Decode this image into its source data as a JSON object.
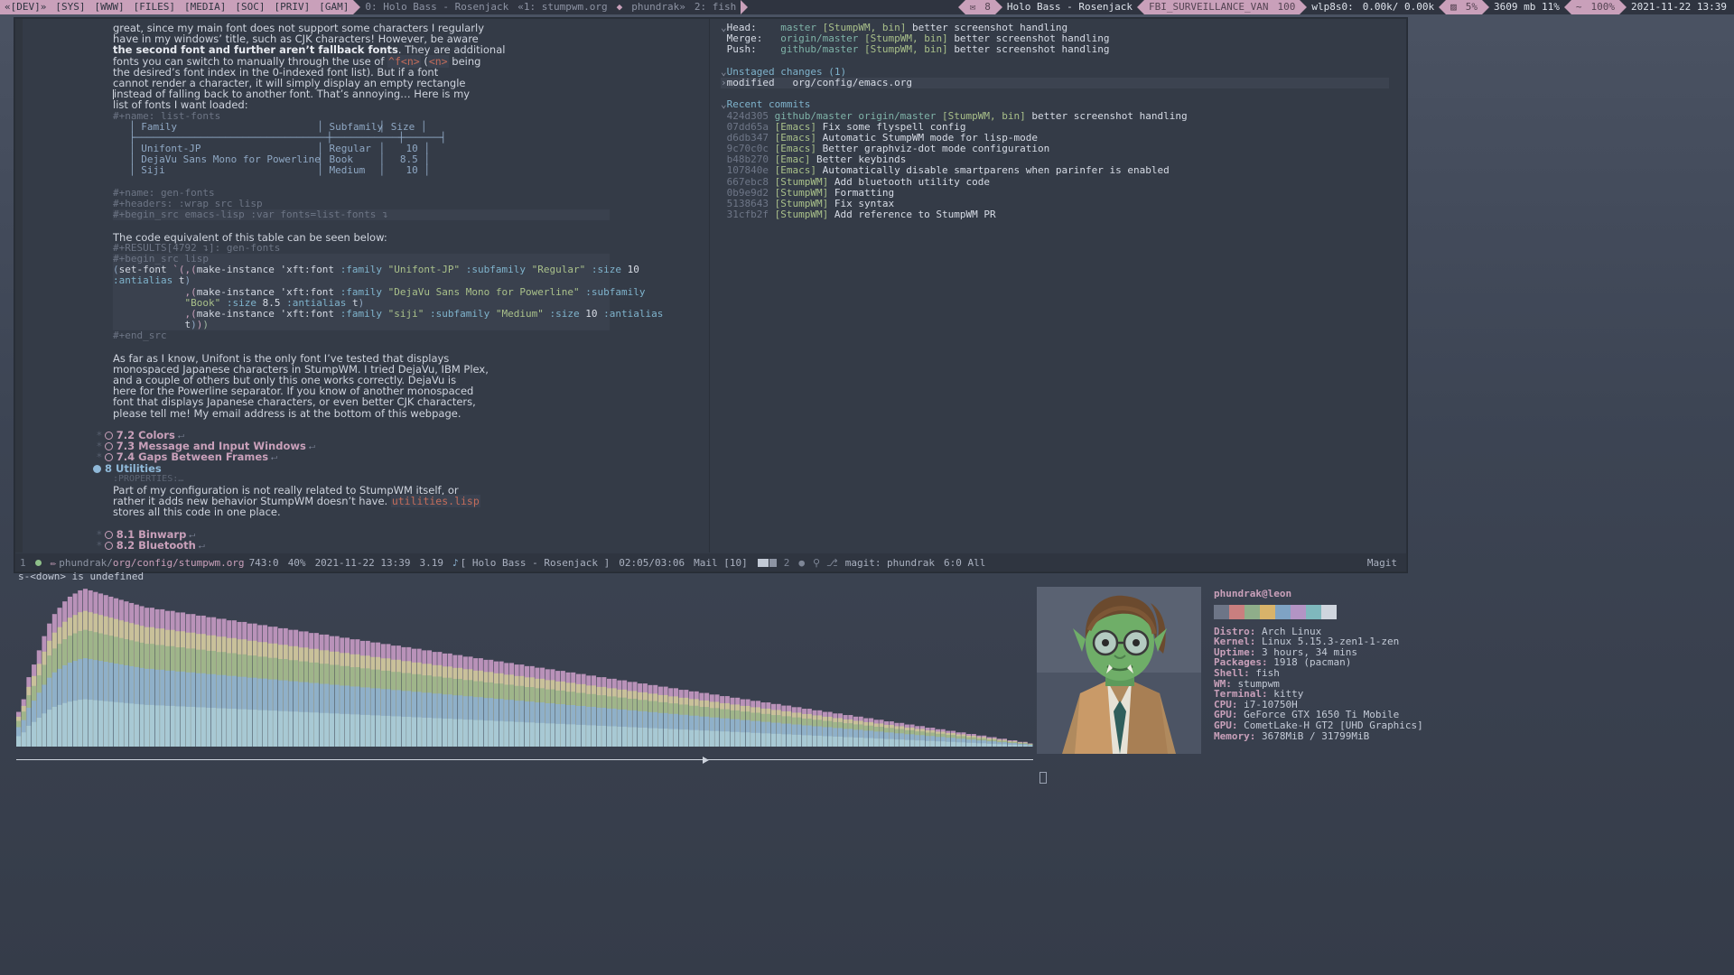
{
  "topbar": {
    "groups": [
      "«[DEV]»",
      "[SYS]",
      "[WWW]",
      "[FILES]",
      "[MEDIA]",
      "[SOC]",
      "[PRIV]",
      "[GAM]"
    ],
    "windows": [
      {
        "label": "0: Holo Bass - Rosenjack",
        "active": false
      },
      {
        "label": "«1: stumpwm.org",
        "active": true
      },
      {
        "label": "phundrak»",
        "active": false
      },
      {
        "label": "2: fish",
        "active": false
      }
    ],
    "mail_icon": "mail-icon",
    "mail_count": "8",
    "now_playing": "Holo Bass - Rosenjack",
    "wifi_ssid": "FBI_SURVEILLANCE_VAN",
    "wifi_strength": "100",
    "net_iface": "wlp8s0:",
    "net_rate": "0.00k/ 0.00k",
    "cpu_icon": "cpu-icon",
    "cpu_pct": "5%",
    "mem": "3609 mb 11%",
    "battery_icon": "~",
    "battery_pct": "100%",
    "datetime": "2021-11-22 13:39"
  },
  "emacs": {
    "left_window": {
      "paragraph_top": [
        "great, since my main font does not support some characters I regularly",
        "have in my windows’ title, such as CJK characters! However, be aware"
      ],
      "bold_sentence": "the second font and further aren’t fallback fonts",
      "paragraph_top_cont": [
        ". They are additional",
        "fonts you can switch to manually through the use of ^f<n> (<n> being",
        "the desired’s font index in the 0-indexed font list). But if a font",
        "cannot render a character, it will simply display an empty rectangle",
        "instead of falling back to another font. That’s annoying… Here is my",
        "list of fonts I want loaded:"
      ],
      "verbatim_1": "^f<n>",
      "verbatim_2": "<n>",
      "table_name": "#+name: list-fonts",
      "table": {
        "headers": [
          "Family",
          "Subfamily",
          "Size"
        ],
        "rows": [
          [
            "Unifont-JP",
            "Regular",
            "10"
          ],
          [
            "DejaVu Sans Mono for Powerline",
            "Book",
            "8.5"
          ],
          [
            "Siji",
            "Medium",
            "10"
          ]
        ]
      },
      "src_name": "#+name: gen-fonts",
      "src_headers": "#+headers: :wrap src lisp",
      "src_begin": "#+begin_src emacs-lisp :var fonts=list-fonts ↴",
      "results_intro": "The code equivalent of this table can be seen below:",
      "results_line": "#+RESULTS[4792 ↴]: gen-fonts",
      "lisp_begin": "#+begin_src lisp",
      "lisp_code": [
        "(set-font `(,(make-instance 'xft:font :family \"Unifont-JP\" :subfamily \"Regular\" :size 10",
        ":antialias t)",
        "            ,(make-instance 'xft:font :family \"DejaVu Sans Mono for Powerline\" :subfamily",
        "            \"Book\" :size 8.5 :antialias t)",
        "            ,(make-instance 'xft:font :family \"siji\" :subfamily \"Medium\" :size 10 :antialias",
        "            t)))"
      ],
      "lisp_end": "#+end_src",
      "paragraph_bottom": [
        "As far as I know, Unifont is the only font I’ve tested that displays",
        "monospaced Japanese characters in StumpWM. I tried DejaVu, IBM Plex,",
        "and a couple of others but only this one works correctly. DejaVu is",
        "here for the Powerline separator. If you know of another monospaced",
        "font that displays Japanese characters, or even better CJK characters,",
        "please tell me! My email address is at the bottom of this webpage."
      ],
      "outline": [
        {
          "label": "7.2 Colors",
          "level": 2,
          "folded": true
        },
        {
          "label": "7.3 Message and Input Windows",
          "level": 2,
          "folded": true
        },
        {
          "label": "7.4 Gaps Between Frames",
          "level": 2,
          "folded": true
        },
        {
          "label": "8 Utilities",
          "level": 1,
          "folded": false
        }
      ],
      "properties_drawer": ":PROPERTIES:…",
      "utilities_text": [
        "Part of my configuration is not really related to StumpWM itself, or",
        "rather it adds new behavior StumpWM doesn’t have. utilities.lisp",
        "stores all this code in one place."
      ],
      "utilities_link": "utilities.lisp",
      "outline_bottom": [
        {
          "label": "8.1 Binwarp",
          "level": 2,
          "folded": true
        },
        {
          "label": "8.2 Bluetooth",
          "level": 2,
          "folded": true
        }
      ]
    },
    "magit": {
      "head_label": "Head:",
      "head_value": "master",
      "head_tags": "[StumpWM, bin]",
      "head_msg": "better screenshot handling",
      "merge_label": "Merge:",
      "merge_value": "origin/master",
      "merge_tags": "[StumpWM, bin]",
      "merge_msg": "better screenshot handling",
      "push_label": "Push:",
      "push_value": "github/master",
      "push_tags": "[StumpWM, bin]",
      "push_msg": "better screenshot handling",
      "unstaged_header": "Unstaged changes (1)",
      "unstaged_item_kind": "modified",
      "unstaged_item_file": "org/config/emacs.org",
      "commits_header": "Recent commits",
      "commits": [
        {
          "hash": "424d305",
          "refs": "github/master origin/master",
          "tag": "[StumpWM, bin]",
          "msg": "better screenshot handling"
        },
        {
          "hash": "07dd65a",
          "refs": "",
          "tag": "[Emacs]",
          "msg": "Fix some flyspell config"
        },
        {
          "hash": "d6db347",
          "refs": "",
          "tag": "[Emacs]",
          "msg": "Automatic StumpWM mode for lisp-mode"
        },
        {
          "hash": "9c70c0c",
          "refs": "",
          "tag": "[Emacs]",
          "msg": "Better graphviz-dot mode configuration"
        },
        {
          "hash": "b48b270",
          "refs": "",
          "tag": "[Emac]",
          "msg": "Better keybinds"
        },
        {
          "hash": "107840e",
          "refs": "",
          "tag": "[Emacs]",
          "msg": "Automatically disable smartparens when parinfer is enabled"
        },
        {
          "hash": "667ebc8",
          "refs": "",
          "tag": "[StumpWM]",
          "msg": "Add bluetooth utility code"
        },
        {
          "hash": "0b9e9d2",
          "refs": "",
          "tag": "[StumpWM]",
          "msg": "Formatting"
        },
        {
          "hash": "5138643",
          "refs": "",
          "tag": "[StumpWM]",
          "msg": "Fix syntax"
        },
        {
          "hash": "31cfb2f",
          "refs": "",
          "tag": "[StumpWM]",
          "msg": "Add reference to StumpWM PR"
        }
      ]
    },
    "modeline": {
      "window_number": "1",
      "path_dim": "phundrak/",
      "path_hl": "org/config/stumpwm.org",
      "position": "743:0",
      "percent": "40%",
      "date": "2021-11-22 13:39",
      "version": "3.19",
      "music_icon": "note-icon",
      "music": "[ Holo Bass - Rosenjack ]",
      "music_time": "02:05/03:06",
      "mail": "Mail [10]",
      "right_window_number": "2",
      "magit_buffer": "magit: phundrak",
      "magit_pos": "6:0 All",
      "magit_mode": "Magit"
    },
    "echo": "s-<down> is undefined"
  },
  "neofetch": {
    "user": "phundrak@leon",
    "palette": [
      "#6d7587",
      "#c97f7f",
      "#8fae8a",
      "#d8b36a",
      "#7fa3c4",
      "#b394c4",
      "#7fb8bd",
      "#cfd5de"
    ],
    "rows": [
      {
        "key": "Distro:",
        "value": "Arch Linux"
      },
      {
        "key": "Kernel:",
        "value": "Linux 5.15.3-zen1-1-zen"
      },
      {
        "key": "Uptime:",
        "value": "3 hours, 34 mins"
      },
      {
        "key": "Packages:",
        "value": "1918 (pacman)"
      },
      {
        "key": "Shell:",
        "value": "fish"
      },
      {
        "key": "WM:",
        "value": "stumpwm"
      },
      {
        "key": "Terminal:",
        "value": "kitty"
      },
      {
        "key": "CPU:",
        "value": "i7-10750H"
      },
      {
        "key": "GPU:",
        "value": "GeForce GTX 1650 Ti Mobile"
      },
      {
        "key": "GPU:",
        "value": "CometLake-H GT2 [UHD Graphics]"
      },
      {
        "key": "Memory:",
        "value": "3678MiB / 31799MiB"
      }
    ]
  },
  "cava": {
    "name": "audio-visualizer",
    "bars": [
      22,
      30,
      44,
      52,
      61,
      70,
      78,
      84,
      88,
      92,
      95,
      97,
      99,
      100,
      99,
      98,
      97,
      96,
      95,
      94,
      93,
      92,
      91,
      90,
      89,
      88,
      88,
      87,
      87,
      86,
      86,
      85,
      85,
      84,
      84,
      83,
      83,
      82,
      82,
      81,
      81,
      80,
      80,
      79,
      79,
      78,
      78,
      77,
      77,
      76,
      76,
      75,
      75,
      74,
      74,
      73,
      73,
      72,
      72,
      71,
      71,
      70,
      70,
      69,
      69,
      68,
      68,
      67,
      67,
      66,
      66,
      65,
      65,
      64,
      64,
      63,
      63,
      62,
      62,
      61,
      61,
      60,
      60,
      59,
      59,
      58,
      58,
      57,
      57,
      56,
      56,
      55,
      55,
      54,
      54,
      53,
      53,
      52,
      52,
      51,
      51,
      50,
      50,
      49,
      49,
      48,
      48,
      47,
      47,
      46,
      46,
      45,
      45,
      44,
      44,
      43,
      43,
      42,
      42,
      41,
      41,
      40,
      40,
      39,
      39,
      38,
      38,
      37,
      37,
      36,
      36,
      35,
      35,
      34,
      34,
      33,
      33,
      32,
      32,
      31,
      31,
      30,
      30,
      29,
      29,
      28,
      28,
      27,
      27,
      26,
      26,
      25,
      25,
      24,
      24,
      23,
      23,
      22,
      22,
      21,
      21,
      20,
      20,
      19,
      19,
      18,
      18,
      17,
      17,
      16,
      16,
      15,
      15,
      14,
      14,
      13,
      13,
      12,
      12,
      11,
      11,
      10,
      10,
      9,
      9,
      8,
      8,
      7,
      7,
      6,
      6,
      5,
      5,
      4,
      4,
      3,
      3,
      2
    ]
  }
}
